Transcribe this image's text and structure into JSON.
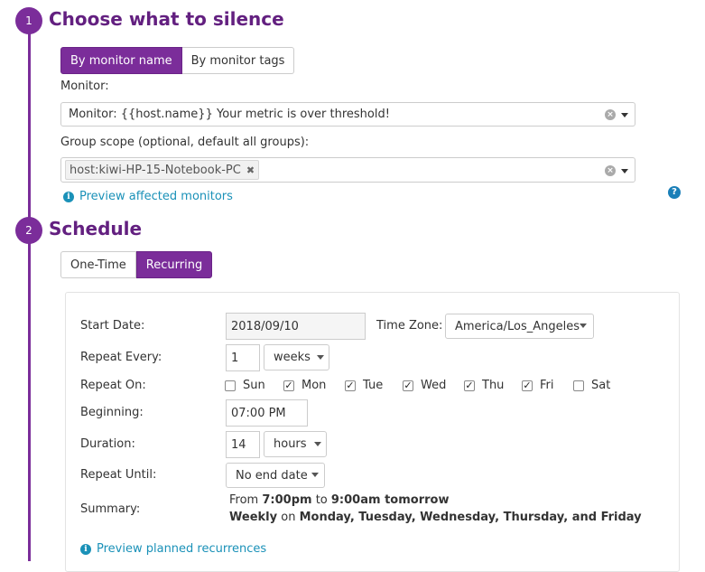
{
  "step1": {
    "number": "1",
    "title": "Choose what to silence",
    "tabs": [
      "By monitor name",
      "By monitor tags"
    ],
    "monitor_label": "Monitor:",
    "monitor_value": "Monitor: {{host.name}} Your metric is over threshold!",
    "group_scope_label": "Group scope (optional, default all groups):",
    "group_tag": "host:kiwi-HP-15-Notebook-PC",
    "preview_link": "Preview affected monitors",
    "help_icon": "?"
  },
  "step2": {
    "number": "2",
    "title": "Schedule",
    "tabs": [
      "One-Time",
      "Recurring"
    ],
    "active_tab": "Recurring"
  },
  "schedule": {
    "start_date_label": "Start Date:",
    "start_date_value": "2018/09/10",
    "time_zone_label": "Time Zone:",
    "time_zone_value": "America/Los_Angeles",
    "repeat_every_label": "Repeat Every:",
    "repeat_every_value": "1",
    "repeat_every_unit": "weeks",
    "repeat_on_label": "Repeat On:",
    "days": [
      {
        "label": "Sun",
        "checked": false
      },
      {
        "label": "Mon",
        "checked": true
      },
      {
        "label": "Tue",
        "checked": true
      },
      {
        "label": "Wed",
        "checked": true
      },
      {
        "label": "Thu",
        "checked": true
      },
      {
        "label": "Fri",
        "checked": true
      },
      {
        "label": "Sat",
        "checked": false
      }
    ],
    "beginning_label": "Beginning:",
    "beginning_value": "07:00 PM",
    "duration_label": "Duration:",
    "duration_value": "14",
    "duration_unit": "hours",
    "repeat_until_label": "Repeat Until:",
    "repeat_until_value": "No end date",
    "summary_label": "Summary:",
    "summary": {
      "from_word": "From",
      "from_time": "7:00pm",
      "to_word": "to",
      "to_time": "9:00am tomorrow",
      "frequency": "Weekly",
      "on_word": "on",
      "days_text": "Monday, Tuesday, Wednesday, Thursday, and Friday"
    },
    "preview_link": "Preview planned recurrences"
  },
  "colors": {
    "accent": "#7b2d9a",
    "title": "#632080",
    "link": "#1a91b8"
  }
}
